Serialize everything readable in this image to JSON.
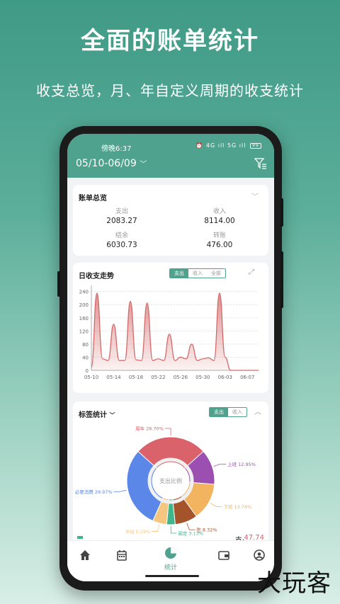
{
  "hero": {
    "title": "全面的账单统计",
    "subtitle": "收支总览，月、年自定义周期的收支统计"
  },
  "status_bar": {
    "time": "傍晚6:37",
    "icons_text": "4G ıll 5G ıll",
    "battery": "99"
  },
  "header": {
    "period": "05/10-06/09",
    "period_icon": "chevron-down-icon",
    "filter_icon": "filter-icon"
  },
  "overview": {
    "title": "账单总览",
    "items": [
      {
        "label": "支出",
        "value": "2083.27"
      },
      {
        "label": "收入",
        "value": "8114.00"
      },
      {
        "label": "结余",
        "value": "6030.73"
      },
      {
        "label": "转账",
        "value": "476.00"
      }
    ]
  },
  "trend": {
    "title": "日收支走势",
    "tabs": [
      {
        "label": "支出",
        "active": true
      },
      {
        "label": "收入",
        "active": false
      },
      {
        "label": "全部",
        "active": false
      }
    ]
  },
  "tags": {
    "title": "标签统计",
    "tabs": [
      {
        "label": "支出",
        "active": true
      },
      {
        "label": "收入",
        "active": false
      }
    ],
    "donut_center": "支出比例",
    "bottom_partial_value": "47.74",
    "bottom_partial_prefix": "支·"
  },
  "nav": {
    "items": [
      {
        "icon": "home-icon",
        "label": ""
      },
      {
        "icon": "calendar-icon",
        "label": ""
      },
      {
        "icon": "pie-chart-icon",
        "label": "统计"
      },
      {
        "icon": "wallet-icon",
        "label": ""
      },
      {
        "icon": "user-icon",
        "label": ""
      }
    ]
  },
  "watermark": "大玩客",
  "chart_data": [
    {
      "type": "area",
      "x": [
        "05-10",
        "05-11",
        "05-12",
        "05-13",
        "05-14",
        "05-15",
        "05-16",
        "05-17",
        "05-18",
        "05-19",
        "05-20",
        "05-21",
        "05-22",
        "05-23",
        "05-24",
        "05-25",
        "05-26",
        "05-27",
        "05-28",
        "05-29",
        "05-30",
        "05-31",
        "06-01",
        "06-02",
        "06-03",
        "06-04",
        "06-05",
        "06-06",
        "06-07",
        "06-08",
        "06-09"
      ],
      "xticks": [
        "05-10",
        "05-14",
        "05-18",
        "05-22",
        "05-26",
        "05-30",
        "06-03",
        "06-07"
      ],
      "yticks": [
        0,
        40,
        80,
        120,
        160,
        200,
        240
      ],
      "ylim": [
        0,
        250
      ],
      "values": [
        10,
        235,
        35,
        30,
        140,
        30,
        30,
        210,
        32,
        30,
        205,
        30,
        35,
        30,
        110,
        30,
        40,
        35,
        80,
        30,
        35,
        38,
        30,
        235,
        40,
        0,
        0,
        0,
        0,
        0,
        0
      ],
      "color": "#d46a6a",
      "grid": true
    },
    {
      "type": "pie",
      "title": "支出比例",
      "slices": [
        {
          "name": "用车",
          "value": 26.7,
          "label": "用车 26.70%",
          "color": "#d9626b"
        },
        {
          "name": "上班",
          "value": 12.95,
          "label": "上班 12.95%",
          "color": "#9b4fb0"
        },
        {
          "name": "下班",
          "value": 13.74,
          "label": "下班 13.74%",
          "color": "#f2b45e"
        },
        {
          "name": "吃",
          "value": 8.32,
          "label": "吃 8.32%",
          "color": "#a4532b"
        },
        {
          "name": "固定",
          "value": 3.13,
          "label": "固定 3.13%",
          "color": "#3fb68a"
        },
        {
          "name": "冲动",
          "value": 5.19,
          "label": "冲动 5.19%",
          "color": "#f5c67f"
        },
        {
          "name": "必要消费",
          "value": 29.97,
          "label": "必要消费 29.97%",
          "color": "#5b87e8"
        }
      ]
    }
  ]
}
